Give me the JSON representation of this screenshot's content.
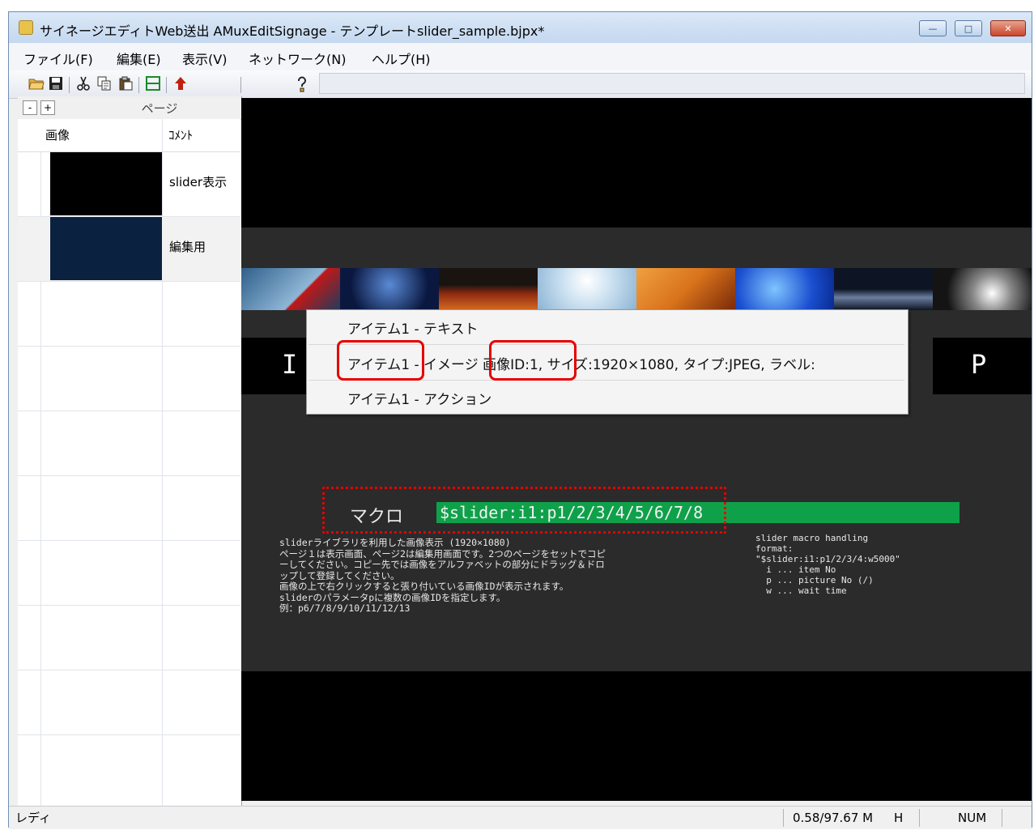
{
  "window": {
    "title": "サイネージエディトWeb送出 AMuxEditSignage - テンプレートslider_sample.bjpx*",
    "controls": {
      "minimize": "—",
      "maximize": "□",
      "close": "✕"
    }
  },
  "menubar": {
    "items": [
      "ファイル(F)",
      "編集(E)",
      "表示(V)",
      "ネットワーク(N)",
      "ヘルプ(H)"
    ]
  },
  "toolbar": {
    "buttons": [
      "open-icon",
      "save-icon",
      "cut-icon",
      "copy-icon",
      "paste-icon",
      "layout-icon",
      "upload-arrow-icon",
      "help-icon"
    ]
  },
  "page_panel": {
    "collapse_label": "-",
    "expand_label": "+",
    "title": "ページ",
    "columns": {
      "image": "画像",
      "comment": "ｺﾒﾝﾄ"
    },
    "rows": [
      {
        "comment": "slider表示",
        "thumb_color": "#000000"
      },
      {
        "comment": "編集用",
        "thumb_color": "#0b2140"
      }
    ]
  },
  "stage": {
    "letters": {
      "left": "I",
      "right": "P"
    },
    "strip_colors": [
      "#1d3c5c",
      "#0a1840",
      "#1a1410",
      "#cfe3f2",
      "#d9731c",
      "#1a4fd0",
      "#0d1524",
      "#141414"
    ],
    "context_menu": {
      "items": [
        "アイテム1 - テキスト",
        "アイテム1 - イメージ 画像ID:1, サイズ:1920×1080, タイプ:JPEG, ラベル:",
        "アイテム1 - アクション"
      ]
    },
    "macro": {
      "label": "マクロ",
      "value": "$slider:i1:p1/2/3/4/5/6/7/8"
    },
    "description_left": "sliderライブラリを利用した画像表示 (1920×1080)\nページ１は表示画面、ページ2は編集用画面です。2つのページをセットでコピ\nーしてください。コピー先では画像をアルファベットの部分にドラッグ＆ドロ\nップして登録してください。\n画像の上で右クリックすると張り付いている画像IDが表示されます。\nsliderのパラメータpに複数の画像IDを指定します。\n例：p6/7/8/9/10/11/12/13",
    "description_right": "slider macro handling\nformat:\n\"$slider:i1:p1/2/3/4:w5000\"\n  i ... item No\n  p ... picture No (/)\n  w ... wait time"
  },
  "statusbar": {
    "status": "レディ",
    "memory": "0.58/97.67 M",
    "h": "H",
    "num": "NUM"
  },
  "colors": {
    "highlight_red": "#e60000",
    "macro_green": "#0fa14a"
  }
}
